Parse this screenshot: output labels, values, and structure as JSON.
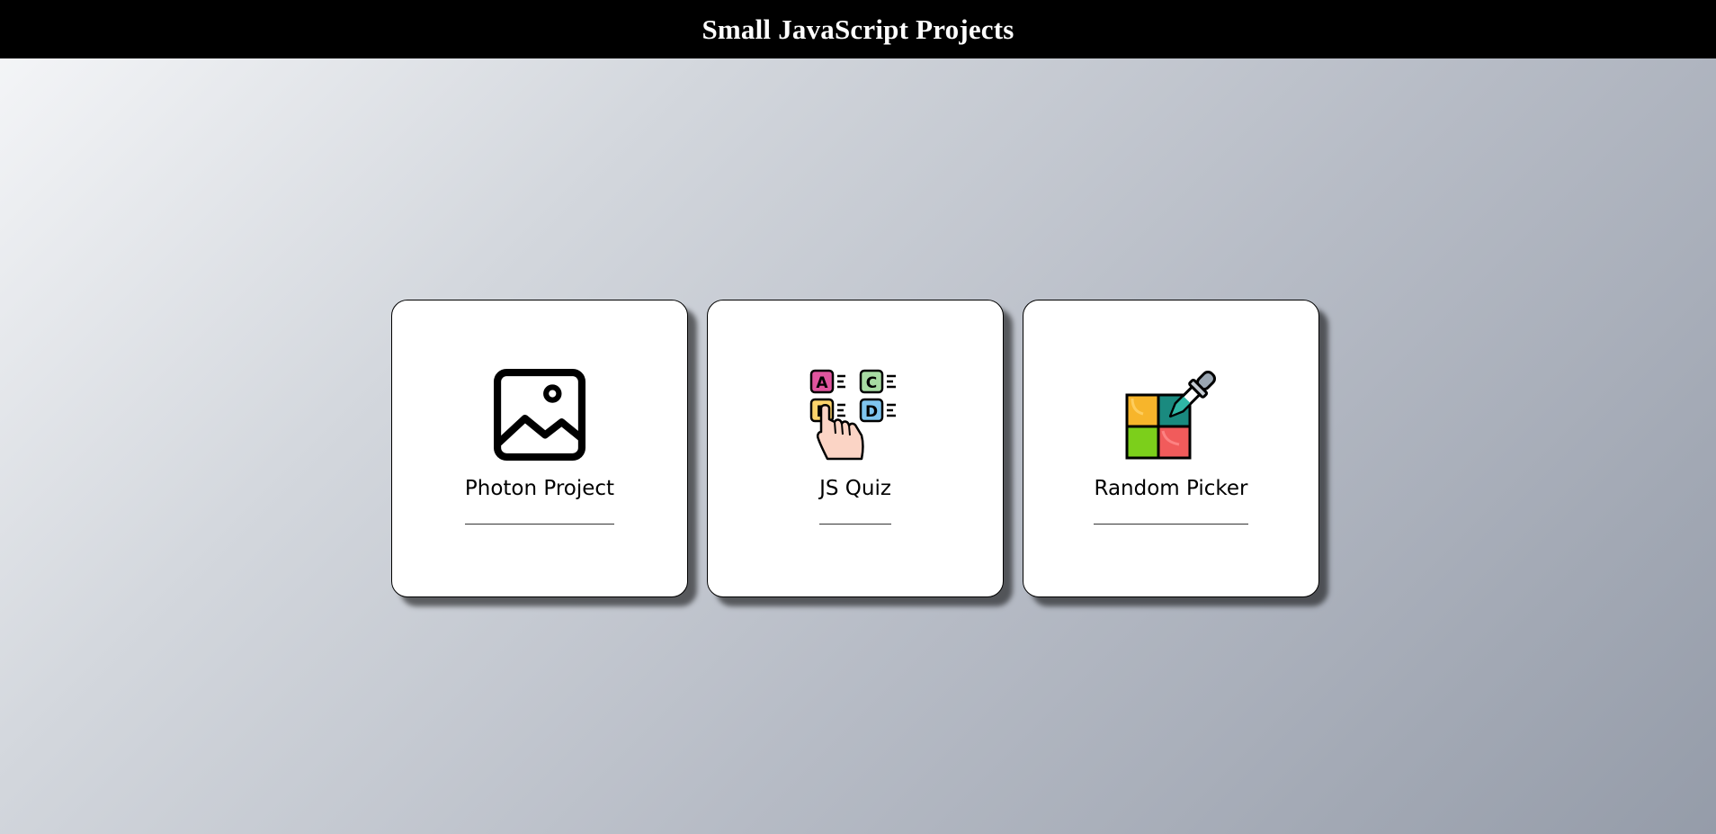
{
  "header": {
    "title": "Small JavaScript Projects"
  },
  "cards": [
    {
      "label": "Photon Project",
      "icon": "image-icon"
    },
    {
      "label": "JS Quiz",
      "icon": "quiz-icon"
    },
    {
      "label": "Random Picker",
      "icon": "color-picker-icon"
    }
  ],
  "quiz_icon_letters": [
    "A",
    "C",
    "B",
    "D"
  ],
  "colors": {
    "header_bg": "#000000",
    "header_text": "#ffffff",
    "card_bg": "#ffffff",
    "quiz_a": "#e0559e",
    "quiz_b": "#fbd36b",
    "quiz_c": "#a8dca3",
    "quiz_d": "#7fc5ef",
    "picker_yellow": "#f7b52b",
    "picker_teal": "#1a8a7f",
    "picker_green": "#7ccf1b",
    "picker_red": "#f15b5b"
  }
}
